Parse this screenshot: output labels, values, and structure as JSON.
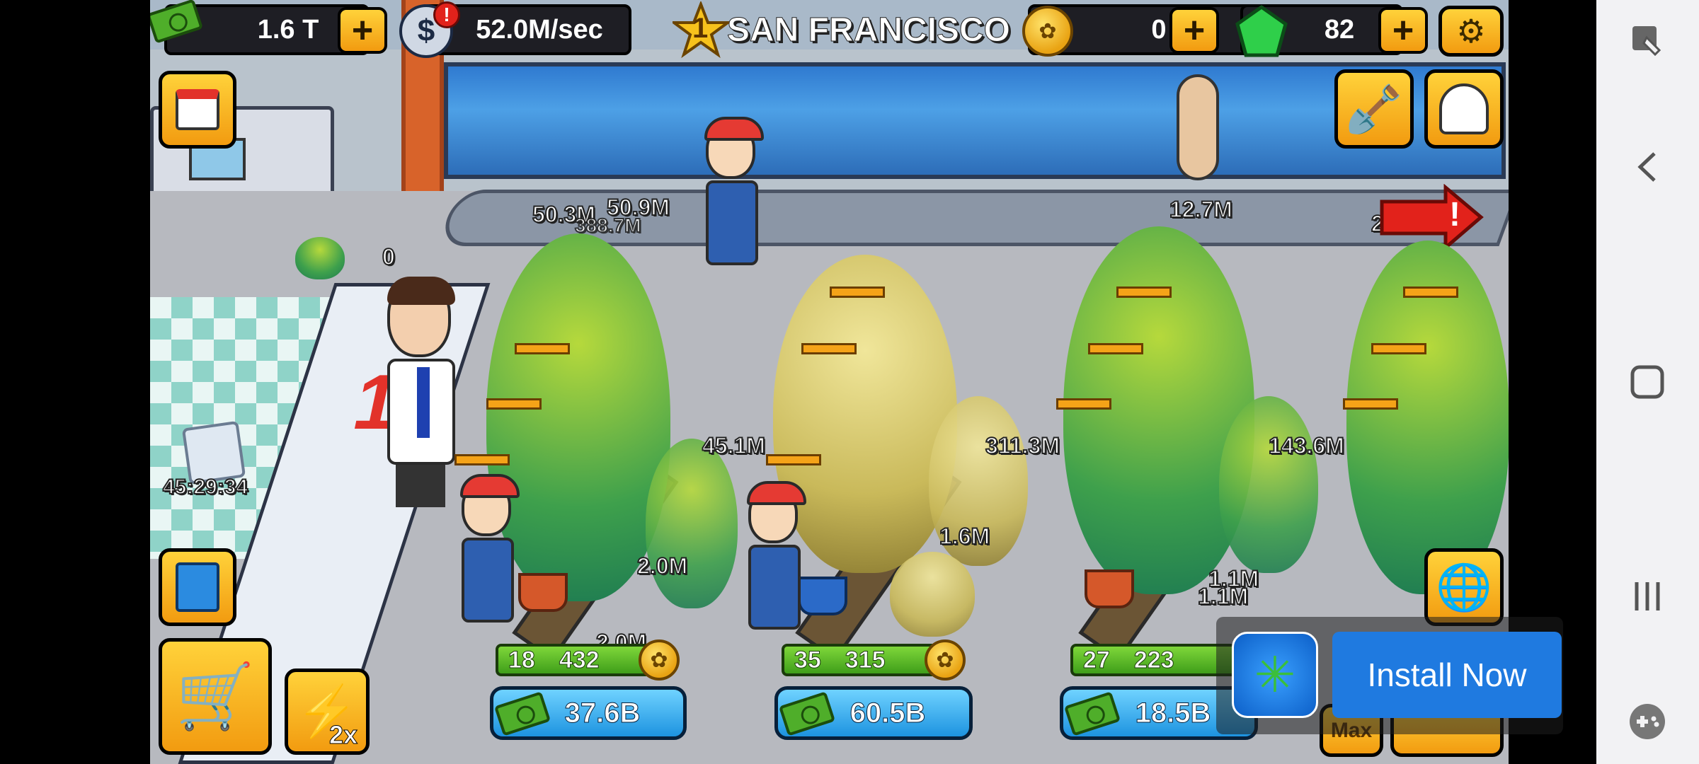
{
  "hud": {
    "cash": "1.6 T",
    "income_rate": "52.0M/sec",
    "income_alert": "!",
    "city_level": "1",
    "city_name": "SAN FRANCISCO",
    "coins": "0",
    "gems": "82",
    "plus": "+"
  },
  "scene": {
    "counter_number": "1",
    "reception_count": "0",
    "mystery_box_timer": "45:29:34",
    "conveyor_values": [
      "50.3M",
      "50.9M",
      "388.7M",
      "12.7M",
      "280"
    ],
    "alert_arrow": "!"
  },
  "rows": [
    {
      "level": "18",
      "count": "432",
      "upgrade_cost": "37.6B",
      "row_values": [
        "45.1M",
        "2.0M",
        "2.0M"
      ]
    },
    {
      "level": "35",
      "count": "315",
      "upgrade_cost": "60.5B",
      "row_values": [
        "311.3M",
        "1.6M"
      ]
    },
    {
      "level": "27",
      "count": "223",
      "upgrade_cost": "18.5B",
      "row_values": [
        "143.6M",
        "1.1M",
        "1.1M"
      ]
    }
  ],
  "boost": {
    "multiplier": "2x"
  },
  "max_label": "Max",
  "ad": {
    "button_label": "Install Now"
  },
  "icons": {
    "calendar": "calendar-icon",
    "shovel": "shovel-icon",
    "profile": "profile-icon",
    "settings": "gear-icon",
    "guide": "book-icon",
    "cart": "cart-icon",
    "globe": "globe-icon"
  },
  "colors": {
    "button_gold": "#f29b10",
    "cost_blue": "#1d93e0",
    "level_green": "#3f9e1a",
    "ad_blue": "#1f7ae0"
  }
}
